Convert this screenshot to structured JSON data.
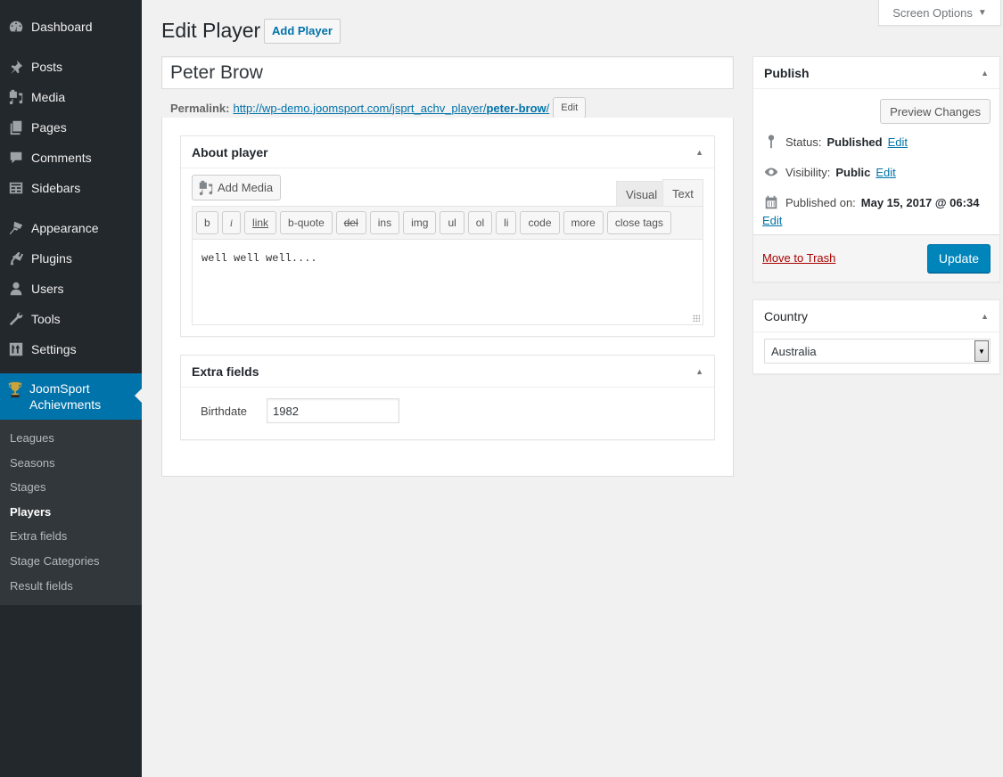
{
  "sidebar": {
    "items": [
      {
        "label": "Dashboard",
        "icon": "dashboard-icon"
      },
      {
        "label": "Posts",
        "icon": "pin-icon"
      },
      {
        "label": "Media",
        "icon": "media-icon"
      },
      {
        "label": "Pages",
        "icon": "pages-icon"
      },
      {
        "label": "Comments",
        "icon": "comment-icon"
      },
      {
        "label": "Sidebars",
        "icon": "sidebars-icon"
      },
      {
        "label": "Appearance",
        "icon": "brush-icon"
      },
      {
        "label": "Plugins",
        "icon": "plug-icon"
      },
      {
        "label": "Users",
        "icon": "user-icon"
      },
      {
        "label": "Tools",
        "icon": "wrench-icon"
      },
      {
        "label": "Settings",
        "icon": "settings-icon"
      }
    ],
    "current": {
      "label": "JoomSport Achievments",
      "icon": "trophy-icon"
    },
    "submenu": [
      "Leagues",
      "Seasons",
      "Stages",
      "Players",
      "Extra fields",
      "Stage Categories",
      "Result fields"
    ],
    "active_submenu": "Players"
  },
  "screen_options": {
    "label": "Screen Options"
  },
  "header": {
    "title": "Edit Player",
    "add_button": "Add Player"
  },
  "post_title": "Peter Brow",
  "permalink": {
    "label": "Permalink:",
    "url_base": "http://wp-demo.joomsport.com/jsprt_achv_player/",
    "slug": "peter-brow",
    "trailing": "/",
    "edit_label": "Edit"
  },
  "about_box": {
    "title": "About player",
    "add_media": "Add Media",
    "tabs": [
      "Visual",
      "Text"
    ],
    "active_tab": "Text",
    "quicktags": [
      "b",
      "i",
      "link",
      "b-quote",
      "del",
      "ins",
      "img",
      "ul",
      "ol",
      "li",
      "code",
      "more",
      "close tags"
    ],
    "content": "well well well...."
  },
  "extra_fields": {
    "title": "Extra fields",
    "fields": [
      {
        "label": "Birthdate",
        "value": "1982"
      }
    ]
  },
  "publish": {
    "title": "Publish",
    "preview_label": "Preview Changes",
    "status_label": "Status:",
    "status_value": "Published",
    "visibility_label": "Visibility:",
    "visibility_value": "Public",
    "published_label": "Published on:",
    "published_value": "May 15, 2017 @ 06:34",
    "edit_label": "Edit",
    "trash_label": "Move to Trash",
    "update_label": "Update"
  },
  "country": {
    "title": "Country",
    "selected": "Australia"
  },
  "colors": {
    "accent": "#0073aa",
    "sidebar_bg": "#23282d",
    "submenu_bg": "#32373c",
    "update_btn": "#0085ba",
    "trash": "#aa0000"
  }
}
